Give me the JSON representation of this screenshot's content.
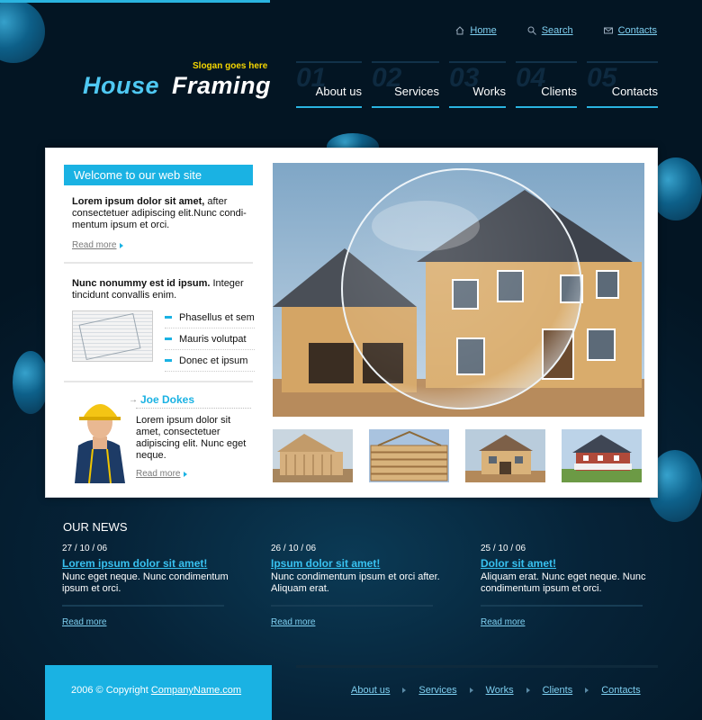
{
  "top_links": [
    {
      "label": "Home",
      "icon": "home-icon"
    },
    {
      "label": "Search",
      "icon": "search-icon"
    },
    {
      "label": "Contacts",
      "icon": "envelope-icon"
    }
  ],
  "brand": {
    "slogan": "Slogan goes here",
    "name_part1": "House",
    "name_part2": "Framing"
  },
  "main_nav": [
    {
      "num": "01",
      "label": "About us"
    },
    {
      "num": "02",
      "label": "Services"
    },
    {
      "num": "03",
      "label": "Works"
    },
    {
      "num": "04",
      "label": "Clients"
    },
    {
      "num": "05",
      "label": "Contacts"
    }
  ],
  "welcome": {
    "title": "Welcome to our web site",
    "intro_bold": "Lorem ipsum dolor sit amet,",
    "intro_text": " after consectetuer adipiscing elit.Nunc condi-mentum ipsum et orci.",
    "read_more": "Read more"
  },
  "section2": {
    "bold": "Nunc nonummy est id ipsum.",
    "text": " Integer tincidunt convallis enim.",
    "bullets": [
      "Phasellus et sem",
      "Mauris volutpat",
      "Donec et ipsum"
    ]
  },
  "person": {
    "name": "Joe Dokes",
    "text": "Lorem ipsum dolor sit amet, consectetuer adipiscing elit. Nunc eget neque.",
    "read_more": "Read more"
  },
  "news": {
    "title": "OUR NEWS",
    "items": [
      {
        "date": "27 / 10 / 06",
        "headline": "Lorem ipsum dolor sit amet!",
        "body": "Nunc eget neque. Nunc condimentum ipsum et orci.",
        "read_more": "Read more"
      },
      {
        "date": "26 / 10 / 06",
        "headline": "Ipsum dolor sit amet!",
        "body": "Nunc condimentum ipsum et orci after. Aliquam erat.",
        "read_more": "Read more"
      },
      {
        "date": "25 / 10 / 06",
        "headline": "Dolor sit amet!",
        "body": "Aliquam erat. Nunc eget neque. Nunc condimentum ipsum et orci.",
        "read_more": "Read more"
      }
    ]
  },
  "footer": {
    "copyright_prefix": "2006 © Copyright",
    "company": "CompanyName.com",
    "links": [
      "About us",
      "Services",
      "Works",
      "Clients",
      "Contacts"
    ]
  },
  "colors": {
    "accent": "#1ab2e3",
    "background": "#031523",
    "slogan": "#f6d600"
  }
}
